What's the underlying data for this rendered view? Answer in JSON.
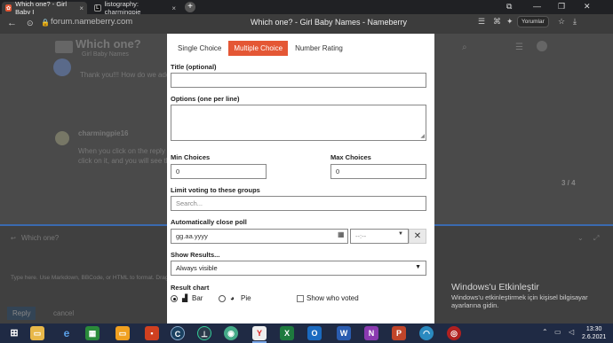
{
  "browser": {
    "tabs": [
      {
        "label": "Which one? - Girl Baby I",
        "close": "×",
        "favicon": "✿",
        "favicon_color": "#e45735"
      },
      {
        "label": "listography: charmingpie",
        "close": "×",
        "favicon": "L",
        "favicon_color": "#111111"
      }
    ],
    "new_tab": "+",
    "url": "forum.nameberry.com",
    "page_title": "Which one? - Girl Baby Names - Nameberry",
    "comments_button": "Yorumlar"
  },
  "background": {
    "topic_title": "Which one?",
    "category": "Girl Baby Names",
    "post1_text": "Thank you!!! How do we add a",
    "poster": "charmingpie16",
    "post2_line1": "When you click on the reply b",
    "post2_line2": "click on it, and you will see th",
    "progress": "3 / 4",
    "reply_to": "Which one?",
    "composer_placeholder": "Type here. Use Markdown, BBCode, or HTML to format. Drag or paste images.",
    "reply_button": "Reply",
    "cancel": "cancel"
  },
  "poll": {
    "tabs": [
      "Single Choice",
      "Multiple Choice",
      "Number Rating"
    ],
    "active_tab": "Multiple Choice",
    "title_label": "Title (optional)",
    "title_value": "",
    "options_label": "Options (one per line)",
    "min_label": "Min Choices",
    "min_value": "0",
    "max_label": "Max Choices",
    "max_value": "0",
    "groups_label": "Limit voting to these groups",
    "groups_placeholder": "Search...",
    "close_label": "Automatically close poll",
    "date_placeholder": "gg.aa.yyyy",
    "time_placeholder": "--:--",
    "clear": "✕",
    "results_label": "Show Results...",
    "results_value": "Always visible",
    "chart_label": "Result chart",
    "chart_bar": "Bar",
    "chart_pie": "Pie",
    "chart_selected": "Bar",
    "show_voters": "Show who voted",
    "accent_color": "#e45735"
  },
  "windows": {
    "activate_title": "Windows'u Etkinleştir",
    "activate_body": "Windows'u etkinleştirmek için kişisel bilgisayar ayarlarına gidin.",
    "time": "13:30",
    "date": "2.6.2021"
  }
}
